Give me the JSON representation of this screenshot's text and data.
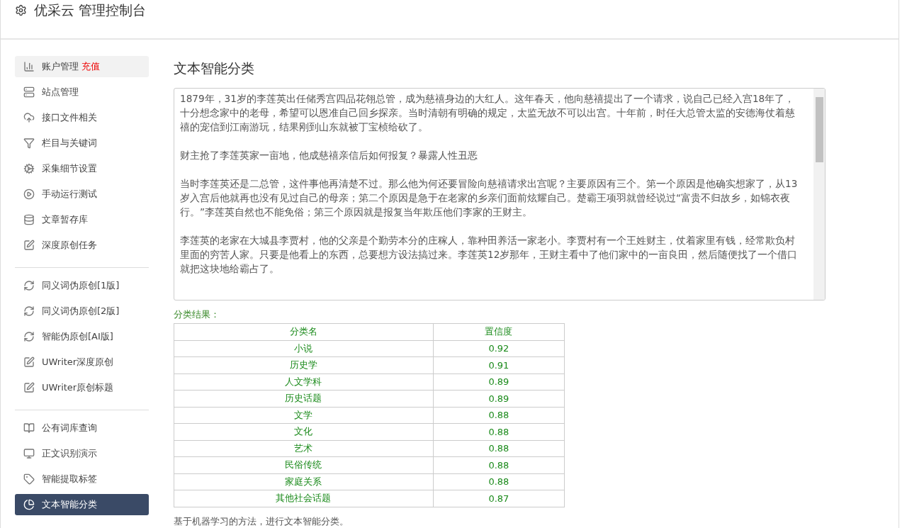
{
  "header": {
    "title": "优采云 管理控制台"
  },
  "sidebar": {
    "groups": [
      {
        "items": [
          {
            "label": "账户管理",
            "badge": "充值",
            "selected": false,
            "hover": true
          },
          {
            "label": "站点管理",
            "selected": false,
            "hover": false
          },
          {
            "label": "接口文件相关",
            "selected": false,
            "hover": false
          },
          {
            "label": "栏目与关键词",
            "selected": false,
            "hover": false
          },
          {
            "label": "采集细节设置",
            "selected": false,
            "hover": false
          },
          {
            "label": "手动运行测试",
            "selected": false,
            "hover": false
          },
          {
            "label": "文章暂存库",
            "selected": false,
            "hover": false
          },
          {
            "label": "深度原创任务",
            "selected": false,
            "hover": false
          }
        ]
      },
      {
        "items": [
          {
            "label": "同义词伪原创[1版]",
            "selected": false,
            "hover": false
          },
          {
            "label": "同义词伪原创[2版]",
            "selected": false,
            "hover": false
          },
          {
            "label": "智能伪原创[AI版]",
            "selected": false,
            "hover": false
          },
          {
            "label": "UWriter深度原创",
            "selected": false,
            "hover": false
          },
          {
            "label": "UWriter原创标题",
            "selected": false,
            "hover": false
          }
        ]
      },
      {
        "items": [
          {
            "label": "公有词库查询",
            "selected": false,
            "hover": false
          },
          {
            "label": "正文识别演示",
            "selected": false,
            "hover": false
          },
          {
            "label": "智能提取标签",
            "selected": false,
            "hover": false
          },
          {
            "label": "文本智能分类",
            "selected": true,
            "hover": false
          }
        ]
      }
    ]
  },
  "main": {
    "title": "文本智能分类",
    "text_input": {
      "paragraphs": [
        "1879年，31岁的李莲英出任储秀宫四品花翎总管，成为慈禧身边的大红人。这年春天，他向慈禧提出了一个请求，说自己已经入宫18年了，十分想念家中的老母，希望可以恩准自己回乡探亲。当时清朝有明确的规定，太监无故不可以出宫。十年前，时任大总管太监的安德海仗着慈禧的宠信到江南游玩，结果刚到山东就被丁宝桢给砍了。",
        "财主抢了李莲英家一亩地，他成慈禧亲信后如何报复？暴露人性丑恶",
        "当时李莲英还是二总管，这件事他再清楚不过。那么他为何还要冒险向慈禧请求出宫呢？主要原因有三个。第一个原因是他确实想家了，从13岁入宫后他就再也没有见过自己的母亲；第二个原因是急于在老家的乡亲们面前炫耀自己。楚霸王项羽就曾经说过“富贵不归故乡，如锦衣夜行。”李莲英自然也不能免俗；第三个原因就是报复当年欺压他们李家的王财主。",
        "李莲英的老家在大城县李贾村，他的父亲是个勤劳本分的庄稼人，靠种田养活一家老小。李贾村有一个王姓财主，仗着家里有钱，经常欺负村里面的穷苦人家。只要是他看上的东西，总要想方设法搞过来。李莲英12岁那年，王财主看中了他们家中的一亩良田，然后随便找了一个借口就把这块地给霸占了。"
      ]
    },
    "result_label": "分类结果：",
    "table": {
      "columns": [
        "分类名",
        "置信度"
      ],
      "rows": [
        [
          "小说",
          "0.92"
        ],
        [
          "历史学",
          "0.91"
        ],
        [
          "人文学科",
          "0.89"
        ],
        [
          "历史话题",
          "0.89"
        ],
        [
          "文学",
          "0.88"
        ],
        [
          "文化",
          "0.88"
        ],
        [
          "艺术",
          "0.88"
        ],
        [
          "民俗传统",
          "0.88"
        ],
        [
          "家庭关系",
          "0.88"
        ],
        [
          "其他社会话题",
          "0.87"
        ]
      ]
    },
    "note": "基于机器学习的方法，进行文本智能分类。"
  }
}
